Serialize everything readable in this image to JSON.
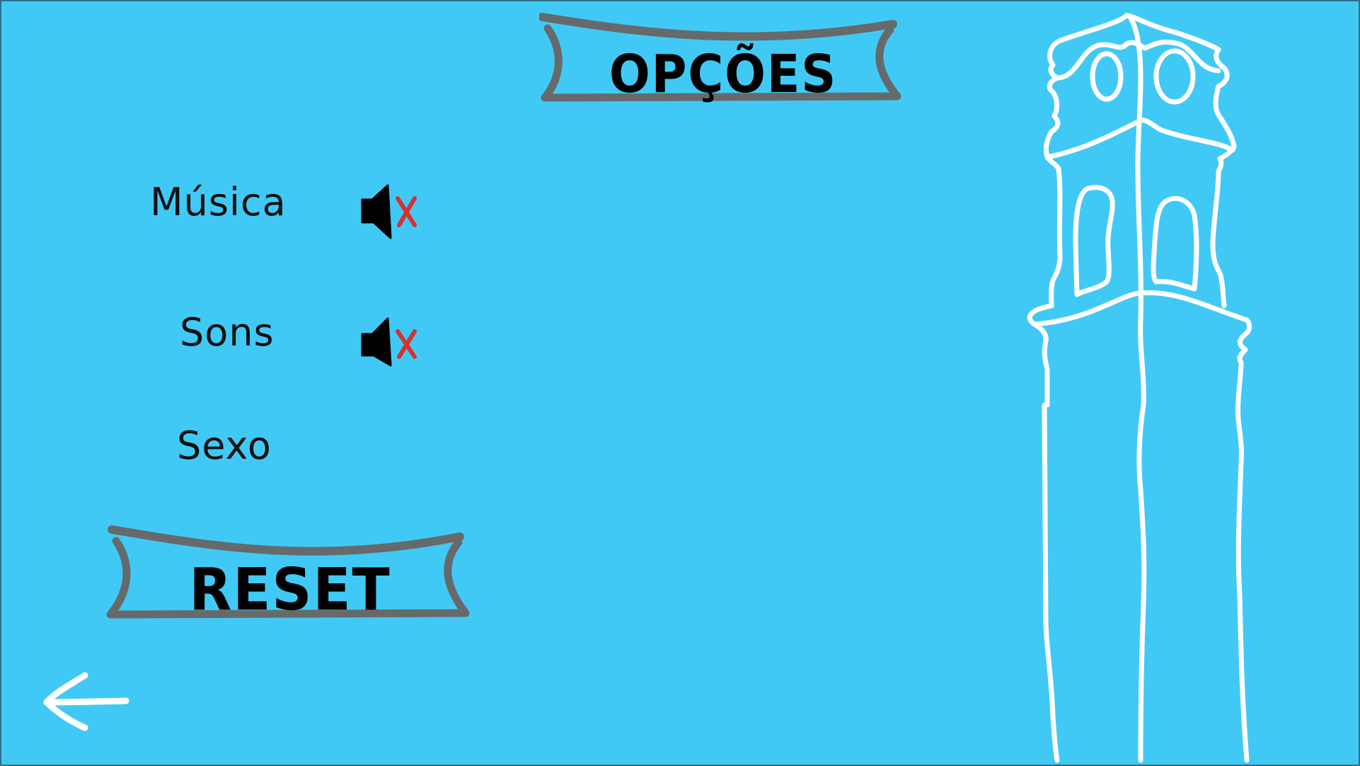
{
  "screen": {
    "title": "OPÇÕES",
    "background_color": "#41c9f6",
    "banner_color": "#666a6b"
  },
  "options": {
    "music_label": "Música",
    "sounds_label": "Sons",
    "gender_label": "Sexo"
  },
  "toggles": {
    "music": {
      "icon": "speaker-muted-icon",
      "state": "muted"
    },
    "sounds": {
      "icon": "speaker-muted-icon",
      "state": "muted"
    },
    "mute_mark_color": "#d83030"
  },
  "buttons": {
    "reset_label": "RESET",
    "back_icon": "arrow-left-icon"
  },
  "decoration": {
    "illustration": "clock-tower-icon",
    "line_color": "#ffffff"
  }
}
